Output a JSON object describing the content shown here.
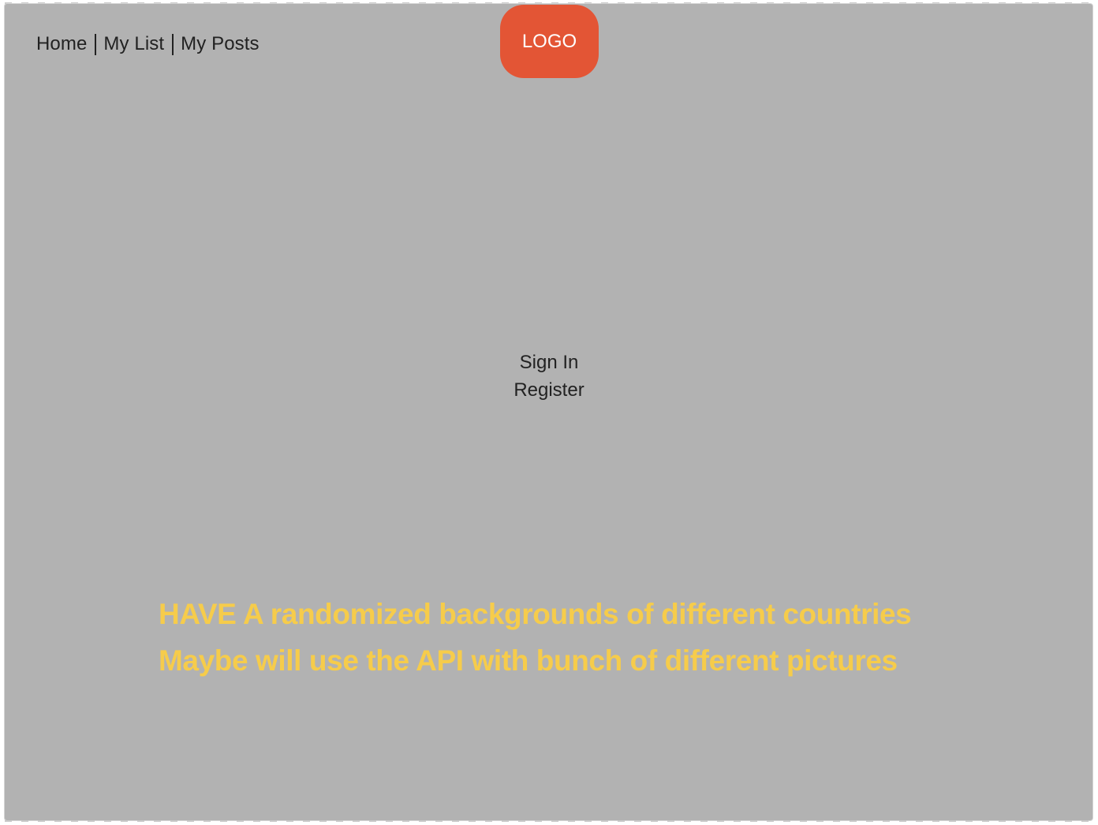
{
  "nav": {
    "items": [
      {
        "label": "Home"
      },
      {
        "label": "My List"
      },
      {
        "label": "My Posts"
      }
    ]
  },
  "logo": {
    "label": "LOGO",
    "color": "#e35535"
  },
  "auth": {
    "sign_in": "Sign In",
    "register": "Register"
  },
  "notes": {
    "line1": "HAVE A randomized backgrounds of different countries",
    "line2": "Maybe will use the API with bunch of different pictures",
    "color": "#f6cc4b"
  },
  "colors": {
    "background": "#b2b2b2",
    "text": "#222222"
  }
}
